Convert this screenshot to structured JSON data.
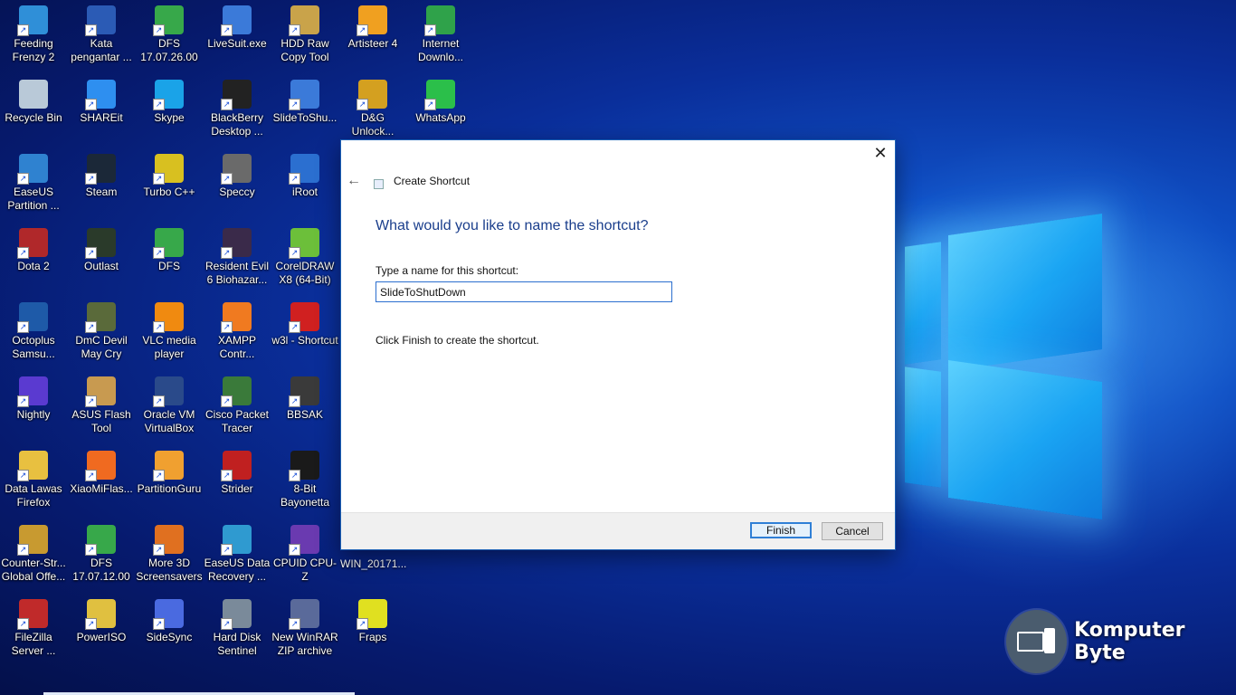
{
  "desktop": {
    "icons": [
      {
        "label": "Feeding Frenzy 2",
        "icon": "game-icon",
        "color": "#2f8fd8"
      },
      {
        "label": "Kata pengantar ...",
        "icon": "word-doc-icon",
        "color": "#2b5bb5"
      },
      {
        "label": "DFS 17.07.26.00",
        "icon": "wifi-signal-icon",
        "color": "#37a84a"
      },
      {
        "label": "LiveSuit.exe",
        "icon": "app-window-icon",
        "color": "#3b7ad9"
      },
      {
        "label": "HDD Raw Copy Tool",
        "icon": "hard-drive-icon",
        "color": "#c9a34a"
      },
      {
        "label": "Artisteer 4",
        "icon": "palette-icon",
        "color": "#f0a020"
      },
      {
        "label": "Internet Downlo...",
        "icon": "globe-download-icon",
        "color": "#2fa24a"
      },
      {
        "label": "Recycle Bin",
        "icon": "recycle-bin-icon",
        "color": "#b9c9d8"
      },
      {
        "label": "SHAREit",
        "icon": "share-icon",
        "color": "#2e8ff0"
      },
      {
        "label": "Skype",
        "icon": "skype-icon",
        "color": "#1aa3e8"
      },
      {
        "label": "BlackBerry Desktop ...",
        "icon": "blackberry-icon",
        "color": "#222222"
      },
      {
        "label": "SlideToShu...",
        "icon": "app-window-icon",
        "color": "#3b7ad9"
      },
      {
        "label": "D&G Unlock...",
        "icon": "dg-logo-icon",
        "color": "#d4a020"
      },
      {
        "label": "WhatsApp",
        "icon": "whatsapp-icon",
        "color": "#2bbf4a"
      },
      {
        "label": "EaseUS Partition ...",
        "icon": "shield-icon",
        "color": "#2f82d0"
      },
      {
        "label": "Steam",
        "icon": "steam-icon",
        "color": "#1b2838"
      },
      {
        "label": "Turbo C++",
        "icon": "turbo-cpp-icon",
        "color": "#d8c020"
      },
      {
        "label": "Speccy",
        "icon": "computer-tower-icon",
        "color": "#6a6a6a"
      },
      {
        "label": "iRoot",
        "icon": "anchor-icon",
        "color": "#2b6fd0"
      },
      {
        "label": "Dota 2",
        "icon": "dota-icon",
        "color": "#b0282a"
      },
      {
        "label": "Outlast",
        "icon": "outlast-icon",
        "color": "#2a3a2a"
      },
      {
        "label": "DFS",
        "icon": "wifi-signal-icon",
        "color": "#37a84a"
      },
      {
        "label": "Resident Evil 6 Biohazar...",
        "icon": "resident-evil-icon",
        "color": "#3a2a4a"
      },
      {
        "label": "CorelDRAW X8 (64-Bit)",
        "icon": "coreldraw-icon",
        "color": "#6cbf3a"
      },
      {
        "label": "Octoplus Samsu...",
        "icon": "octoplus-icon",
        "color": "#1e5aa8"
      },
      {
        "label": "DmC Devil May Cry",
        "icon": "dmc-icon",
        "color": "#5a6a3a"
      },
      {
        "label": "VLC media player",
        "icon": "vlc-cone-icon",
        "color": "#f08a10"
      },
      {
        "label": "XAMPP Contr...",
        "icon": "xampp-icon",
        "color": "#f07a20"
      },
      {
        "label": "w3l - Shortcut",
        "icon": "w3l-icon",
        "color": "#d02020"
      },
      {
        "label": "Nightly",
        "icon": "firefox-nightly-icon",
        "color": "#5a3ad0"
      },
      {
        "label": "ASUS Flash Tool",
        "icon": "package-box-icon",
        "color": "#c89a50"
      },
      {
        "label": "Oracle VM VirtualBox",
        "icon": "virtualbox-icon",
        "color": "#2a4a8a"
      },
      {
        "label": "Cisco Packet Tracer",
        "icon": "cisco-icon",
        "color": "#3a7a3a"
      },
      {
        "label": "BBSAK",
        "icon": "bbsak-icon",
        "color": "#3a3a3a"
      },
      {
        "label": "Data Lawas Firefox",
        "icon": "folder-icon",
        "color": "#e8c040"
      },
      {
        "label": "XiaoMiFlas...",
        "icon": "mi-icon",
        "color": "#f06a20"
      },
      {
        "label": "PartitionGuru",
        "icon": "partition-icon",
        "color": "#f0a030"
      },
      {
        "label": "Strider",
        "icon": "strider-icon",
        "color": "#c02020"
      },
      {
        "label": "8-Bit Bayonetta",
        "icon": "bayonetta-icon",
        "color": "#1a1a1a"
      },
      {
        "label": "Counter-Str... Global Offe...",
        "icon": "csgo-icon",
        "color": "#c89a30"
      },
      {
        "label": "DFS 17.07.12.00",
        "icon": "wifi-signal-icon",
        "color": "#37a84a"
      },
      {
        "label": "More 3D Screensavers",
        "icon": "screensaver-icon",
        "color": "#e07020"
      },
      {
        "label": "EaseUS Data Recovery ...",
        "icon": "recovery-icon",
        "color": "#2f9ad0"
      },
      {
        "label": "CPUID CPU-Z",
        "icon": "cpu-z-icon",
        "color": "#6a3ab0"
      },
      {
        "label": "FileZilla Server ...",
        "icon": "filezilla-icon",
        "color": "#c02a2a"
      },
      {
        "label": "PowerISO",
        "icon": "disc-icon",
        "color": "#e0c040"
      },
      {
        "label": "SideSync",
        "icon": "sidesync-icon",
        "color": "#4a6ae0"
      },
      {
        "label": "Hard Disk Sentinel",
        "icon": "hdd-sentinel-icon",
        "color": "#7a8a9a"
      },
      {
        "label": "New WinRAR ZIP archive",
        "icon": "zip-archive-icon",
        "color": "#5a6a9a"
      },
      {
        "label": "Fraps",
        "icon": "fraps-icon",
        "color": "#e0e020"
      }
    ],
    "behind_dialog_label": "WIN_20171..."
  },
  "dialog": {
    "title": "Create Shortcut",
    "heading": "What would you like to name the shortcut?",
    "field_label": "Type a name for this shortcut:",
    "name_value": "SlideToShutDown",
    "hint": "Click Finish to create the shortcut.",
    "finish_label": "Finish",
    "cancel_label": "Cancel",
    "close_glyph": "✕",
    "back_glyph": "←"
  },
  "watermark": {
    "text": "Komputer Byte"
  },
  "shortcut_arrow_glyph": "↗",
  "colors": {
    "accent": "#2b6fcf",
    "heading": "#1a3e8c",
    "desktop": "#0a2e9a"
  }
}
